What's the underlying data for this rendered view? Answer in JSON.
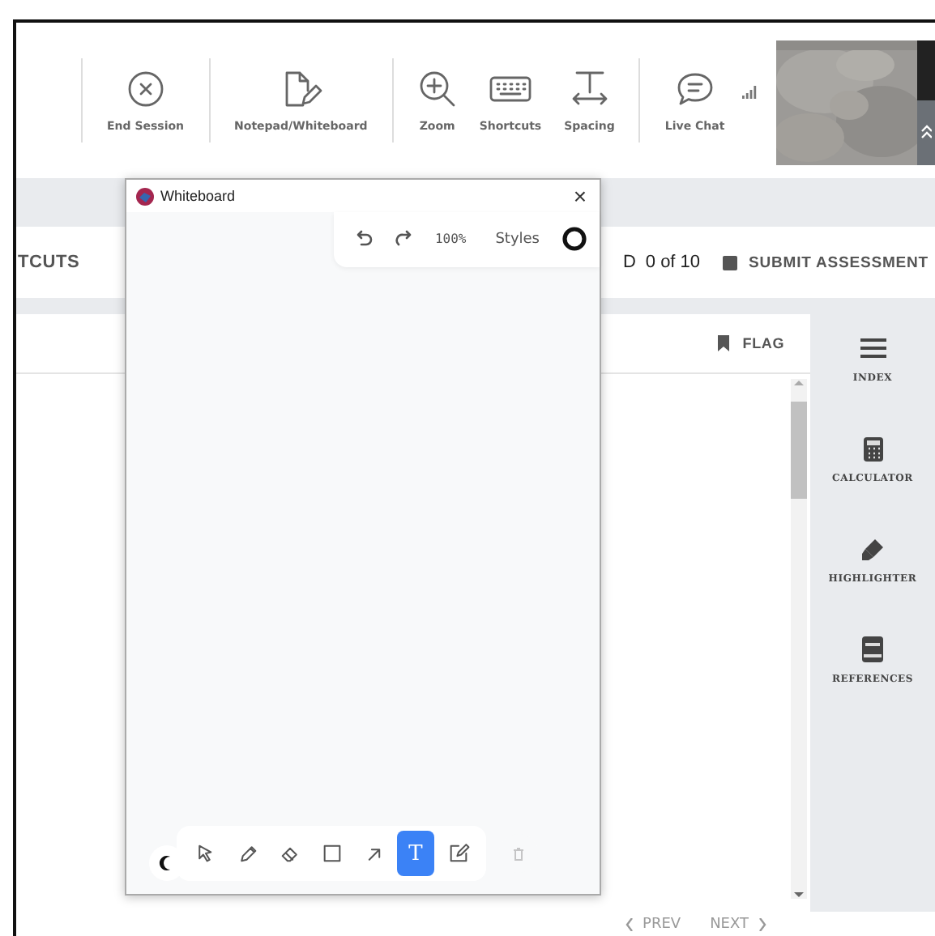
{
  "toolbar": {
    "groups": [
      {
        "buttons": [
          {
            "label": "End Session"
          }
        ]
      },
      {
        "buttons": [
          {
            "label": "Notepad/Whiteboard"
          }
        ]
      },
      {
        "buttons": [
          {
            "label": "Zoom"
          },
          {
            "label": "Shortcuts"
          },
          {
            "label": "Spacing"
          }
        ]
      },
      {
        "buttons": [
          {
            "label": "Live Chat"
          }
        ]
      }
    ]
  },
  "nav_bar": {
    "left_text": "TCUTS",
    "progress_label": "D",
    "progress": "0 of 10",
    "submit": "SUBMIT ASSESSMENT"
  },
  "question_panel": {
    "flag": "FLAG"
  },
  "sidebar": {
    "items": [
      {
        "label": "INDEX"
      },
      {
        "label": "CALCULATOR"
      },
      {
        "label": "HIGHLIGHTER"
      },
      {
        "label": "REFERENCES"
      }
    ]
  },
  "pager": {
    "prev": "PREV",
    "next": "NEXT"
  },
  "whiteboard": {
    "title": "Whiteboard",
    "close": "×",
    "zoom": "100%",
    "styles": "Styles",
    "tools": [
      {
        "selected": false
      },
      {
        "selected": false
      },
      {
        "selected": false
      },
      {
        "selected": false
      },
      {
        "selected": false
      },
      {
        "glyph": "T",
        "selected": true
      },
      {
        "selected": false
      }
    ],
    "delete": {
      "disabled": true
    }
  }
}
